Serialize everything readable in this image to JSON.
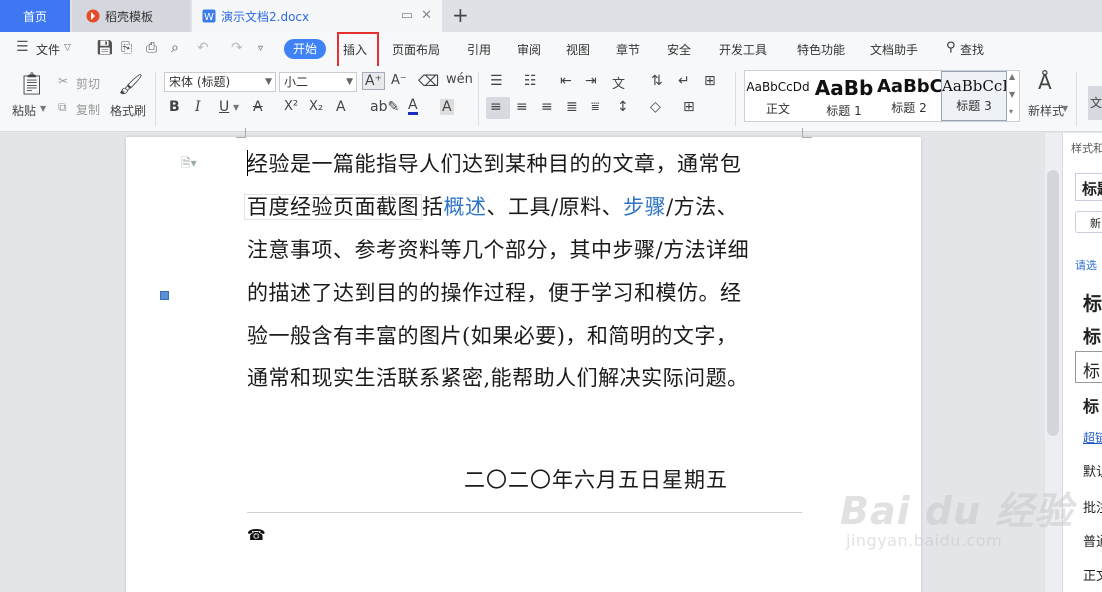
{
  "tabs": {
    "home": "首页",
    "template": "稻壳模板",
    "document": "演示文档2.docx"
  },
  "menu": {
    "file": "文件",
    "start": "开始",
    "items": [
      "插入",
      "页面布局",
      "引用",
      "审阅",
      "视图",
      "章节",
      "安全",
      "开发工具",
      "特色功能",
      "文档助手"
    ],
    "search": "查找",
    "highlighted_item": "插入"
  },
  "ribbon": {
    "paste": "粘贴",
    "cut": "剪切",
    "copy": "复制",
    "format_painter": "格式刷",
    "font_name": "宋体 (标题)",
    "font_size": "小二",
    "styles": [
      {
        "preview": "AaBbCcDd",
        "label": "正文"
      },
      {
        "preview": "AaBb",
        "label": "标题 1"
      },
      {
        "preview": "AaBbC",
        "label": "标题 2"
      },
      {
        "preview": "AaBbCcD",
        "label": "标题 3"
      }
    ],
    "new_style": "新样式",
    "more_label": "文"
  },
  "document": {
    "line1": "经验是一篇能指导人们达到某种目的的文章，通常包",
    "line2_caption": "百度经验页面截图",
    "line2_a": "括",
    "line2_link1": "概述",
    "line2_b": "、工具/原料、",
    "line2_link2": "步骤",
    "line2_c": "/方法、",
    "line3": "注意事项、参考资料等几个部分，其中步骤/方法详细",
    "line4": "的描述了达到目的的操作过程，便于学习和模仿。经",
    "line5": "验一般含有丰富的图片(如果必要)，和简明的文字，",
    "line6": "通常和现实生活联系紧密,能帮助人们解决实际问题。",
    "date": "二〇二〇年六月五日星期五",
    "phone_icon": "☎"
  },
  "right_pane": {
    "title": "样式和",
    "current": "标题",
    "new_btn": "新",
    "select_hint": "请选",
    "list": [
      "标",
      "标",
      "标",
      "标",
      "超链",
      "默认",
      "批注",
      "普通",
      "正文"
    ]
  },
  "watermark": {
    "logo": "Bai du 经验",
    "url": "jingyan.baidu.com"
  }
}
